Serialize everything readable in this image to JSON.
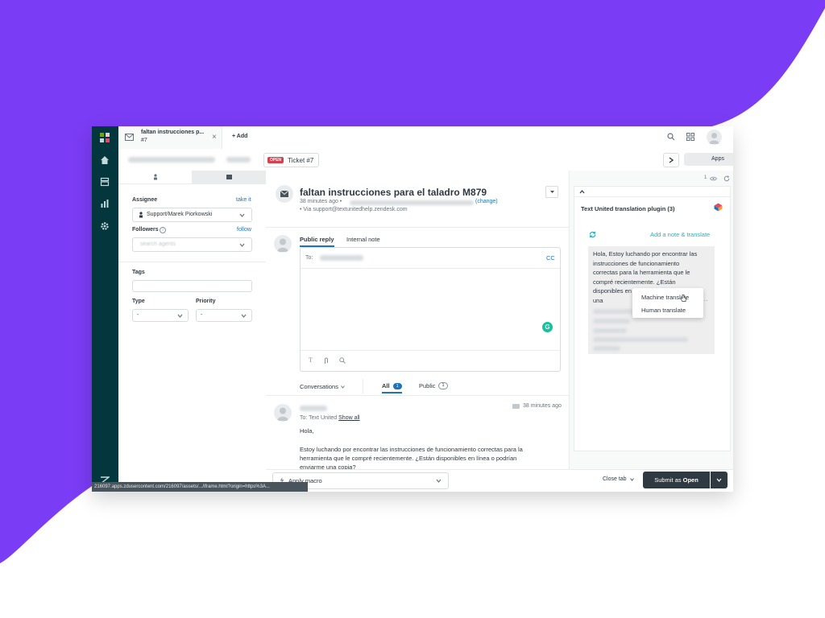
{
  "colors": {
    "brand_purple": "#7b3cf5",
    "rail": "#03363d",
    "status_open": "#d93f4c",
    "submit": "#2f3941",
    "teal": "#30aabc",
    "grammarly": "#15c39a"
  },
  "tab": {
    "title": "faltan instrucciones p...",
    "subtitle": "#7",
    "add_label": "+ Add"
  },
  "subbar": {
    "status_badge": "OPEN",
    "ticket_label": "Ticket #7",
    "apps_label": "Apps"
  },
  "left": {
    "assignee_label": "Assignee",
    "take_it": "take it",
    "assignee_value": "Support/Marek Piorkowski",
    "followers_label": "Followers",
    "follow": "follow",
    "followers_placeholder": "search agents",
    "tags_label": "Tags",
    "type_label": "Type",
    "type_value": "-",
    "priority_label": "Priority",
    "priority_value": "-"
  },
  "ticket": {
    "subject": "faltan instrucciones para el taladro M879",
    "meta_time": "38 minutes ago •",
    "change_link": "(change)",
    "via": "• Via support@textunitedhelp.zendesk.com"
  },
  "composer": {
    "tab_public": "Public reply",
    "tab_internal": "Internal note",
    "to_label": "To:",
    "cc_label": "CC"
  },
  "conversations": {
    "filter_label": "Conversations",
    "all_label": "All",
    "all_count": "1",
    "public_label": "Public",
    "public_count": "1"
  },
  "message": {
    "time": "38 minutes ago",
    "to_text": "To: Text United",
    "show_all": "Show all",
    "greeting": "Hola,",
    "body": "Estoy luchando por encontrar las instrucciones de funcionamiento correctas para la herramienta que le compré recientemente. ¿Están disponibles en línea o podrían enviarme una copia?"
  },
  "plugin": {
    "eye_count": "1",
    "title": "Text United translation plugin (3)",
    "add_note": "Add a note & translate",
    "card_text": "Hola, Estoy luchando por encontrar las instrucciones de funcionamiento correctas para la herramienta que le compré recientemente. ¿Están disponibles en línea o podrían enviarme una",
    "menu_machine": "Machine translate",
    "menu_human": "Human translate"
  },
  "footer": {
    "apply_macro": "Apply macro",
    "close_tab": "Close tab",
    "submit_prefix": "Submit as ",
    "submit_status": "Open"
  },
  "status_url": "216097.apps.zdusercontent.com/216097/assets/.../iframe.html?origin=https%3A..."
}
